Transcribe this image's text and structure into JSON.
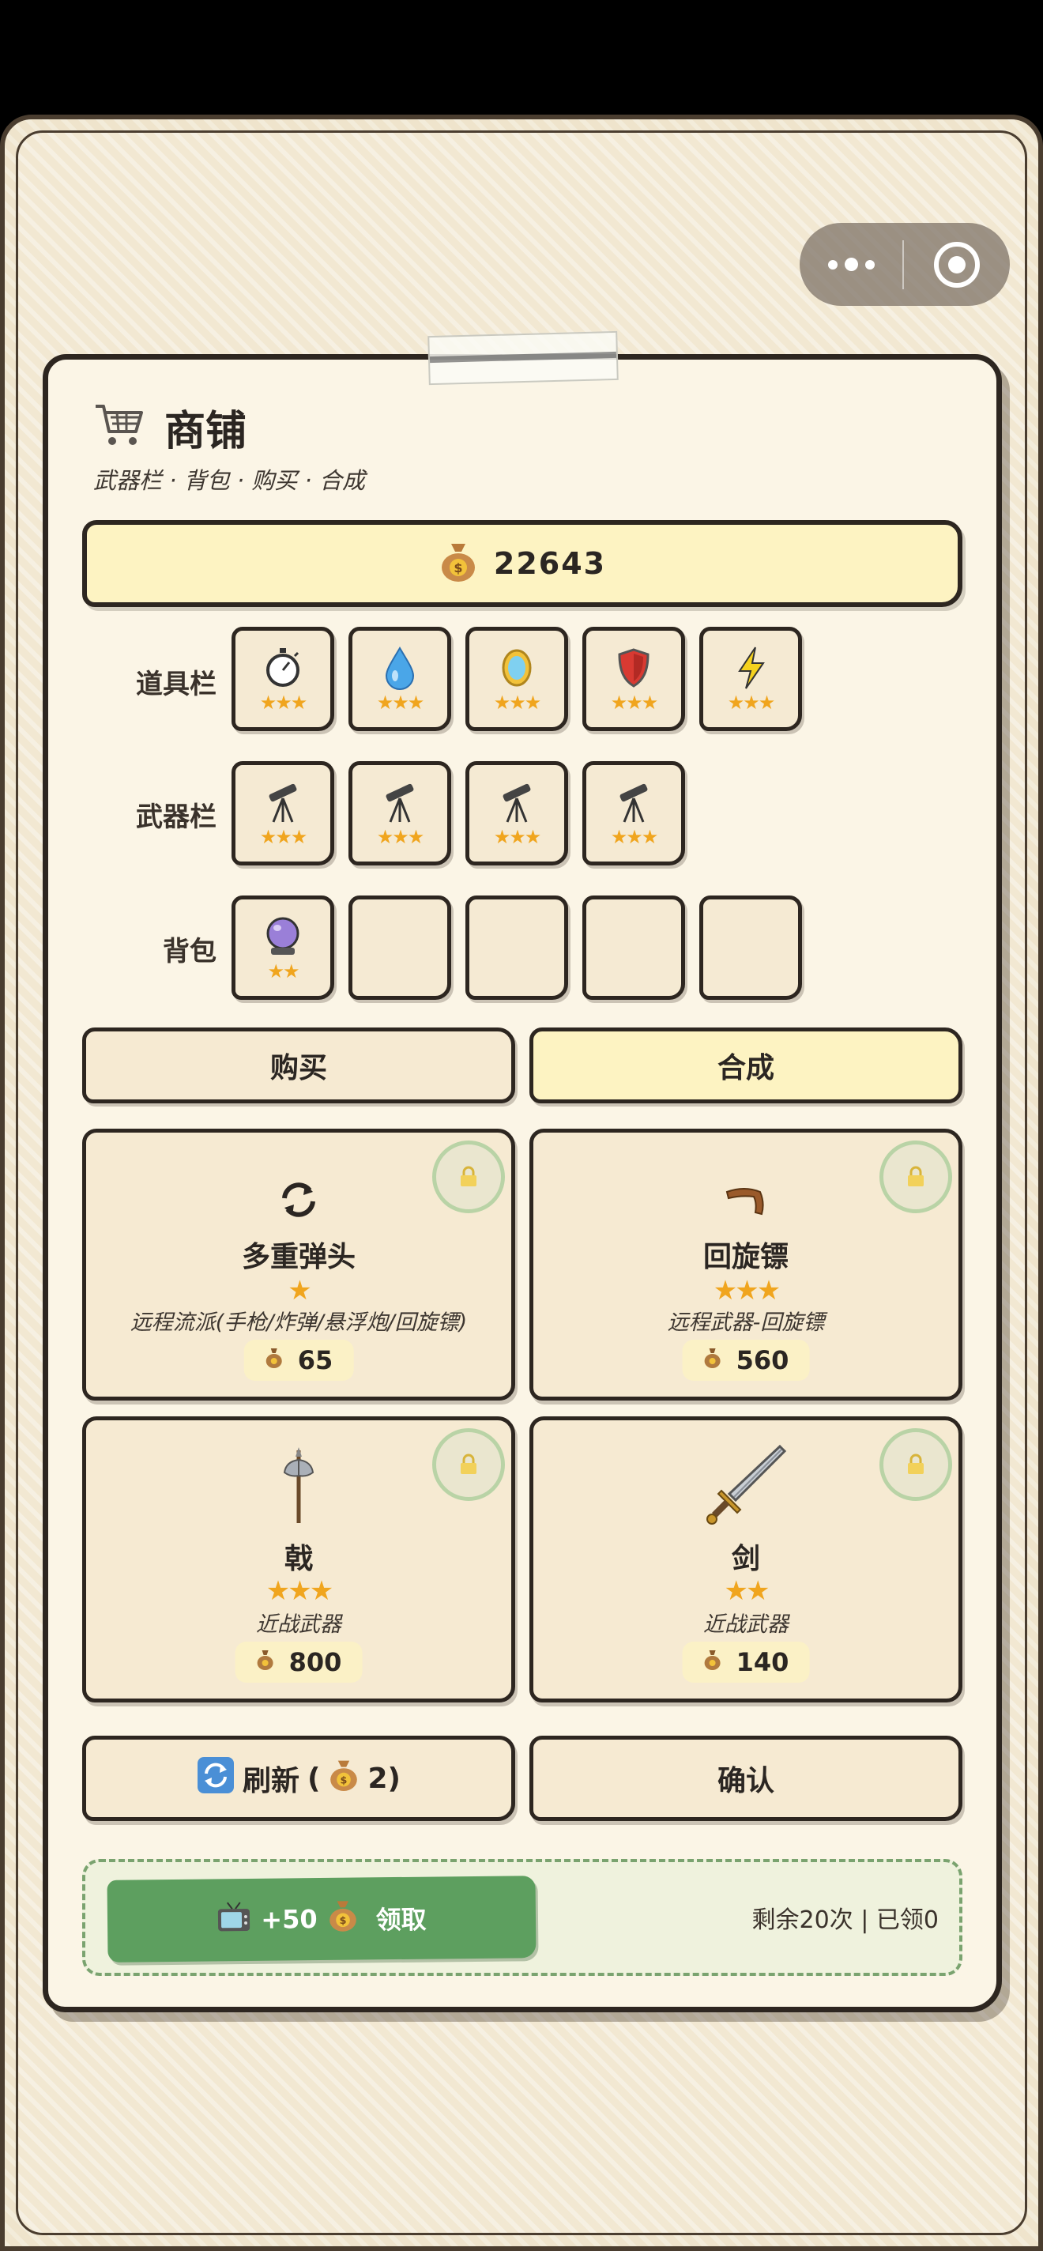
{
  "capsule": {
    "more_icon": "more-dots-icon",
    "close_icon": "target-close-icon"
  },
  "shop": {
    "title": "商铺",
    "subtitle": "武器栏 · 背包 · 购买 · 合成",
    "coins": "22643"
  },
  "rows": {
    "props_label": "道具栏",
    "weapons_label": "武器栏",
    "backpack_label": "背包"
  },
  "props": [
    {
      "icon": "stopwatch-icon",
      "stars": "★★★"
    },
    {
      "icon": "water-drop-icon",
      "stars": "★★★"
    },
    {
      "icon": "mirror-icon",
      "stars": "★★★"
    },
    {
      "icon": "shield-icon",
      "stars": "★★★"
    },
    {
      "icon": "lightning-icon",
      "stars": "★★★"
    }
  ],
  "weapons": [
    {
      "icon": "telescope-icon",
      "stars": "★★★"
    },
    {
      "icon": "telescope-icon",
      "stars": "★★★"
    },
    {
      "icon": "telescope-icon",
      "stars": "★★★"
    },
    {
      "icon": "telescope-icon",
      "stars": "★★★"
    }
  ],
  "backpack": [
    {
      "icon": "crystal-ball-icon",
      "stars": "★★"
    },
    {
      "icon": "",
      "stars": ""
    },
    {
      "icon": "",
      "stars": ""
    },
    {
      "icon": "",
      "stars": ""
    },
    {
      "icon": "",
      "stars": ""
    }
  ],
  "tabs": {
    "buy": "购买",
    "merge": "合成",
    "active": "merge",
    "active_color": "#fdf3c2"
  },
  "cards": [
    {
      "name": "多重弹头",
      "stars": "★",
      "desc": "远程流派(手枪/炸弹/悬浮炮/回旋镖)",
      "price": "65",
      "icon": "refresh-arrows-icon"
    },
    {
      "name": "回旋镖",
      "stars": "★★★",
      "desc": "远程武器-回旋镖",
      "price": "560",
      "icon": "boomerang-icon"
    },
    {
      "name": "戟",
      "stars": "★★★",
      "desc": "近战武器",
      "price": "800",
      "icon": "halberd-icon"
    },
    {
      "name": "剑",
      "stars": "★★",
      "desc": "近战武器",
      "price": "140",
      "icon": "sword-icon"
    }
  ],
  "actions": {
    "refresh_label": "刷新",
    "refresh_open": "(",
    "refresh_cost": "2)",
    "confirm_label": "确认"
  },
  "reward": {
    "amount": "+50",
    "claim_label": "领取",
    "remaining": "剩余20次 | 已领0"
  },
  "colors": {
    "star": "#f0a51e",
    "claim_green": "#5d9f5f",
    "panel": "#fbf5e6",
    "coin_bar": "#fdf3c2"
  }
}
